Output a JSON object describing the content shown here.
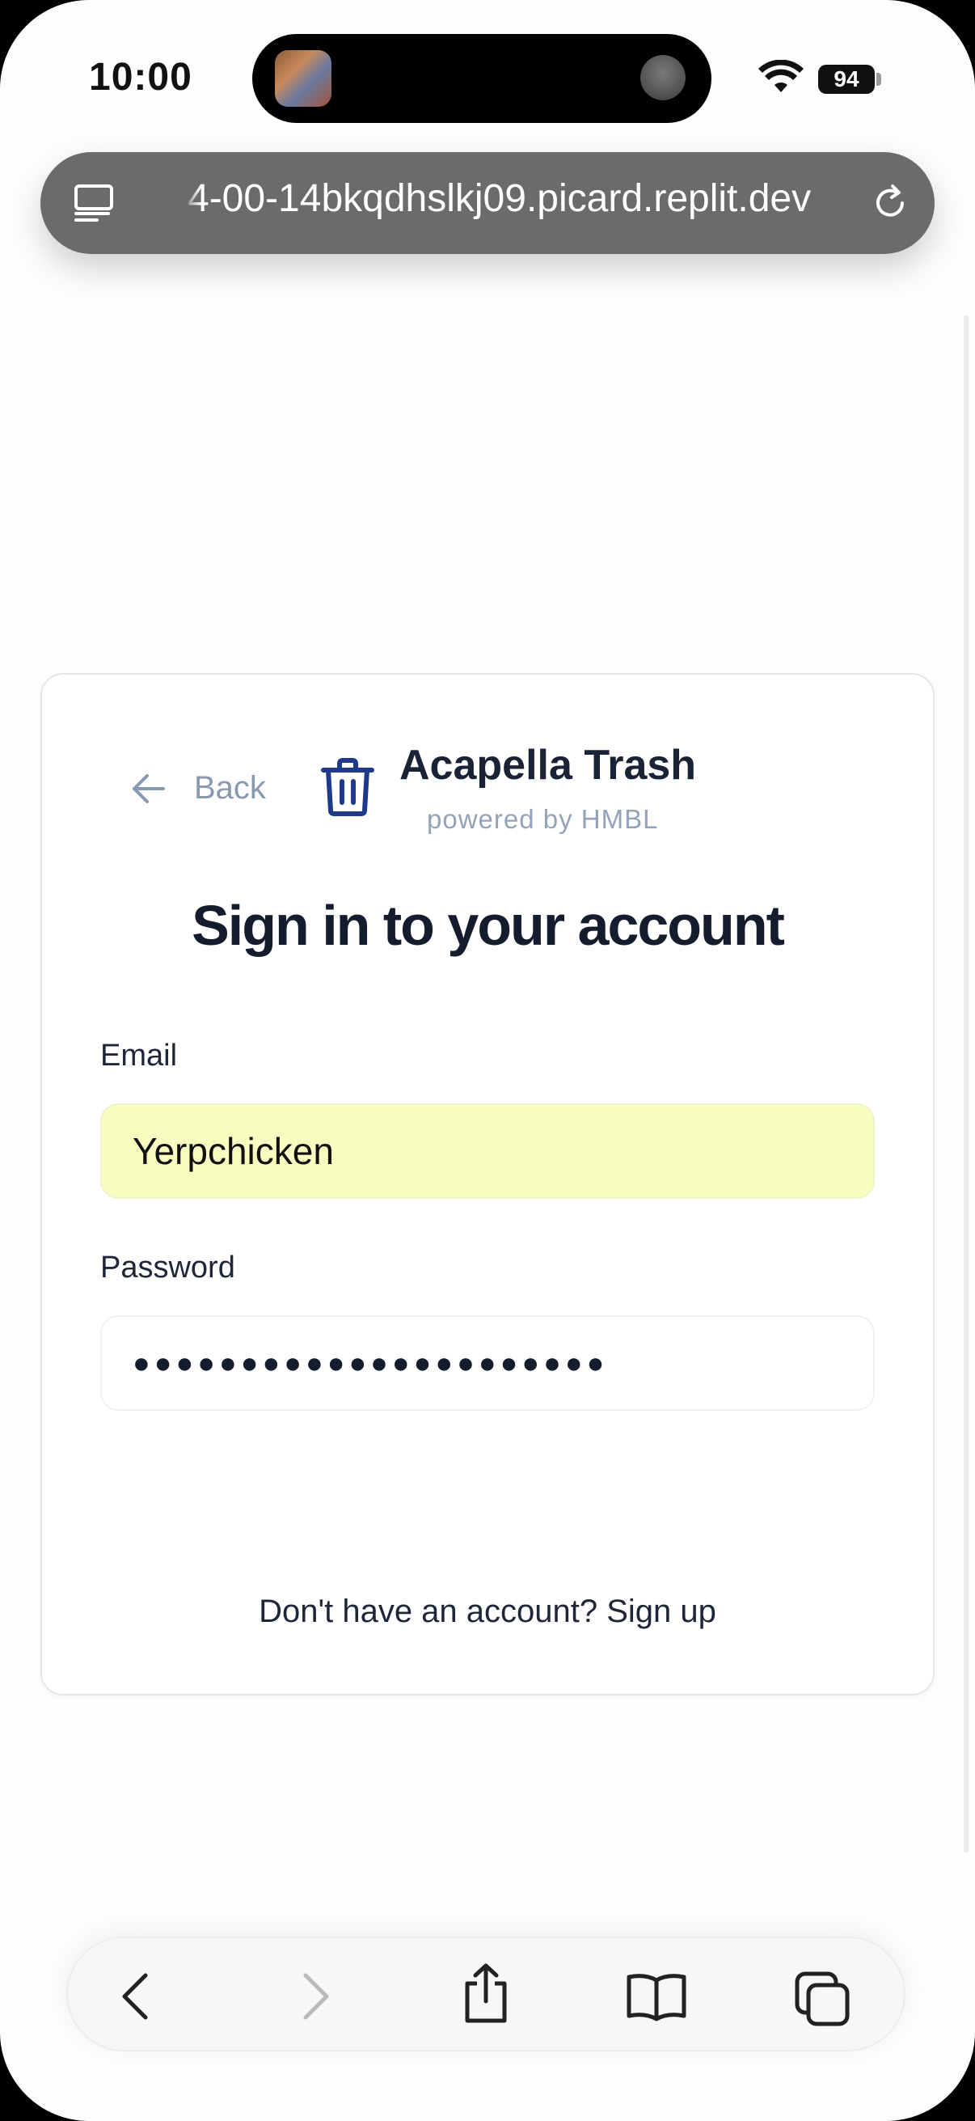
{
  "status_bar": {
    "time": "10:00",
    "battery": "94"
  },
  "browser": {
    "url": "4-00-14bkqdhslkj09.picard.replit.dev"
  },
  "card": {
    "back_label": "Back",
    "brand_title": "Acapella Trash",
    "brand_subtitle": "powered by HMBL",
    "heading": "Sign in to your account",
    "email_label": "Email",
    "email_value": "Yerpchicken",
    "password_label": "Password",
    "password_mask": "●●●●●●●●●●●●●●●●●●●●●●",
    "signup_prompt": "Don't have an account? ",
    "signup_link": "Sign up"
  },
  "toolbar": {
    "icons": [
      "back-icon",
      "forward-icon",
      "share-icon",
      "bookmarks-icon",
      "tabs-icon"
    ]
  },
  "colors": {
    "heading": "#141c2e",
    "muted": "#8a99b2",
    "brand_icon": "#1e3a8a",
    "email_autofill_bg": "#fafdc0",
    "url_bar_bg": "#6b6b6b"
  }
}
